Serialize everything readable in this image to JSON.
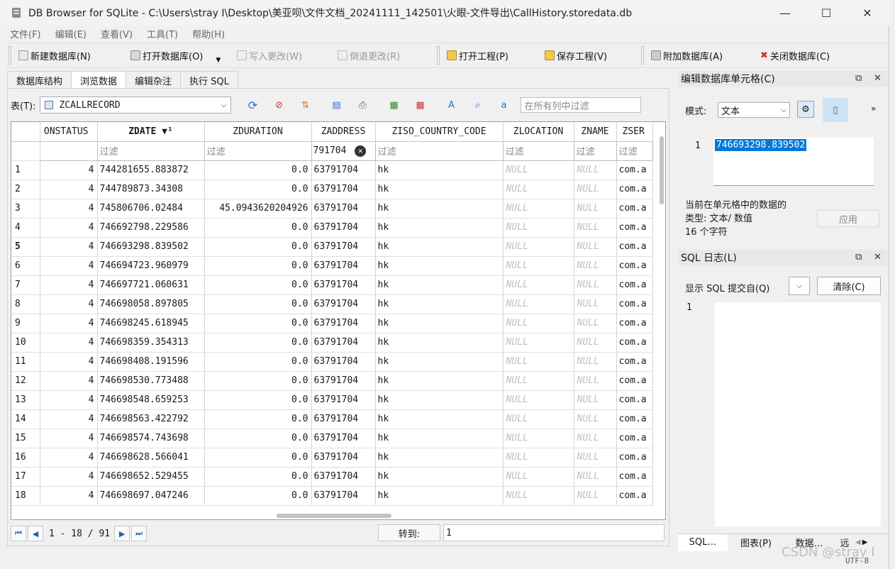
{
  "window": {
    "title": "DB Browser for SQLite - C:\\Users\\stray I\\Desktop\\美亚呗\\文件文档_20241111_142501\\火眼-文件导出\\CallHistory.storedata.db",
    "minimize": "—",
    "maximize": "☐",
    "close": "✕"
  },
  "menu": [
    "文件(F)",
    "编辑(E)",
    "查看(V)",
    "工具(T)",
    "帮助(H)"
  ],
  "toolbar": {
    "new_db": "新建数据库(N)",
    "open_db": "打开数据库(O)",
    "write_changes": "写入更改(W)",
    "revert_changes": "倒退更改(R)",
    "open_project": "打开工程(P)",
    "save_project": "保存工程(V)",
    "attach_db": "附加数据库(A)",
    "close_db": "关闭数据库(C)"
  },
  "tabs": [
    "数据库结构",
    "浏览数据",
    "编辑杂注",
    "执行 SQL"
  ],
  "browse": {
    "table_label": "表(T):",
    "table_value": "ZCALLRECORD",
    "filter_all_placeholder": "在所有列中过滤",
    "columns": [
      "ONSTATUS",
      "ZDATE ▼¹",
      "ZDURATION",
      "ZADDRESS",
      "ZISO_COUNTRY_CODE",
      "ZLOCATION",
      "ZNAME",
      "ZSER"
    ],
    "filter_placeholder": "过滤",
    "address_filter": "791704",
    "rows": [
      {
        "n": "1",
        "status": "4",
        "date": "744281655.883872",
        "duration": "0.0",
        "address": "63791704",
        "iso": "hk",
        "loc": "NULL",
        "name": "NULL",
        "ser": "com.a"
      },
      {
        "n": "2",
        "status": "4",
        "date": "744789873.34308",
        "duration": "0.0",
        "address": "63791704",
        "iso": "hk",
        "loc": "NULL",
        "name": "NULL",
        "ser": "com.a"
      },
      {
        "n": "3",
        "status": "4",
        "date": "745806706.02484",
        "duration": "45.0943620204926",
        "address": "63791704",
        "iso": "hk",
        "loc": "NULL",
        "name": "NULL",
        "ser": "com.a"
      },
      {
        "n": "4",
        "status": "4",
        "date": "746692798.229586",
        "duration": "0.0",
        "address": "63791704",
        "iso": "hk",
        "loc": "NULL",
        "name": "NULL",
        "ser": "com.a"
      },
      {
        "n": "5",
        "status": "4",
        "date": "746693298.839502",
        "duration": "0.0",
        "address": "63791704",
        "iso": "hk",
        "loc": "NULL",
        "name": "NULL",
        "ser": "com.a"
      },
      {
        "n": "6",
        "status": "4",
        "date": "746694723.960979",
        "duration": "0.0",
        "address": "63791704",
        "iso": "hk",
        "loc": "NULL",
        "name": "NULL",
        "ser": "com.a"
      },
      {
        "n": "7",
        "status": "4",
        "date": "746697721.060631",
        "duration": "0.0",
        "address": "63791704",
        "iso": "hk",
        "loc": "NULL",
        "name": "NULL",
        "ser": "com.a"
      },
      {
        "n": "8",
        "status": "4",
        "date": "746698058.897805",
        "duration": "0.0",
        "address": "63791704",
        "iso": "hk",
        "loc": "NULL",
        "name": "NULL",
        "ser": "com.a"
      },
      {
        "n": "9",
        "status": "4",
        "date": "746698245.618945",
        "duration": "0.0",
        "address": "63791704",
        "iso": "hk",
        "loc": "NULL",
        "name": "NULL",
        "ser": "com.a"
      },
      {
        "n": "10",
        "status": "4",
        "date": "746698359.354313",
        "duration": "0.0",
        "address": "63791704",
        "iso": "hk",
        "loc": "NULL",
        "name": "NULL",
        "ser": "com.a"
      },
      {
        "n": "11",
        "status": "4",
        "date": "746698408.191596",
        "duration": "0.0",
        "address": "63791704",
        "iso": "hk",
        "loc": "NULL",
        "name": "NULL",
        "ser": "com.a"
      },
      {
        "n": "12",
        "status": "4",
        "date": "746698530.773488",
        "duration": "0.0",
        "address": "63791704",
        "iso": "hk",
        "loc": "NULL",
        "name": "NULL",
        "ser": "com.a"
      },
      {
        "n": "13",
        "status": "4",
        "date": "746698548.659253",
        "duration": "0.0",
        "address": "63791704",
        "iso": "hk",
        "loc": "NULL",
        "name": "NULL",
        "ser": "com.a"
      },
      {
        "n": "14",
        "status": "4",
        "date": "746698563.422792",
        "duration": "0.0",
        "address": "63791704",
        "iso": "hk",
        "loc": "NULL",
        "name": "NULL",
        "ser": "com.a"
      },
      {
        "n": "15",
        "status": "4",
        "date": "746698574.743698",
        "duration": "0.0",
        "address": "63791704",
        "iso": "hk",
        "loc": "NULL",
        "name": "NULL",
        "ser": "com.a"
      },
      {
        "n": "16",
        "status": "4",
        "date": "746698628.566041",
        "duration": "0.0",
        "address": "63791704",
        "iso": "hk",
        "loc": "NULL",
        "name": "NULL",
        "ser": "com.a"
      },
      {
        "n": "17",
        "status": "4",
        "date": "746698652.529455",
        "duration": "0.0",
        "address": "63791704",
        "iso": "hk",
        "loc": "NULL",
        "name": "NULL",
        "ser": "com.a"
      },
      {
        "n": "18",
        "status": "4",
        "date": "746698697.047246",
        "duration": "0.0",
        "address": "63791704",
        "iso": "hk",
        "loc": "NULL",
        "name": "NULL",
        "ser": "com.a"
      }
    ],
    "pager_text": "1 - 18 / 91",
    "goto_label": "转到:",
    "goto_value": "1"
  },
  "edit_cell": {
    "title": "编辑数据库单元格(C)",
    "mode_label": "模式:",
    "mode_value": "文本",
    "line_no": "1",
    "cell_value": "746693298.839502",
    "info_line1": "当前在单元格中的数据的",
    "info_line2": "类型: 文本/ 数值",
    "info_line3": "16 个字符",
    "apply": "应用"
  },
  "sql_log": {
    "title": "SQL 日志(L)",
    "show_label": "显示 SQL 提交自(Q)",
    "clear": "清除(C)",
    "line_no": "1"
  },
  "bottom_tabs": [
    "SQL…",
    "图表(P)",
    "数据…",
    "远"
  ],
  "status": {
    "encoding": "UTF-8",
    "watermark": "CSDN @stray I"
  },
  "colors": {
    "accent": "#0078d7",
    "selection": "#0078d7"
  }
}
